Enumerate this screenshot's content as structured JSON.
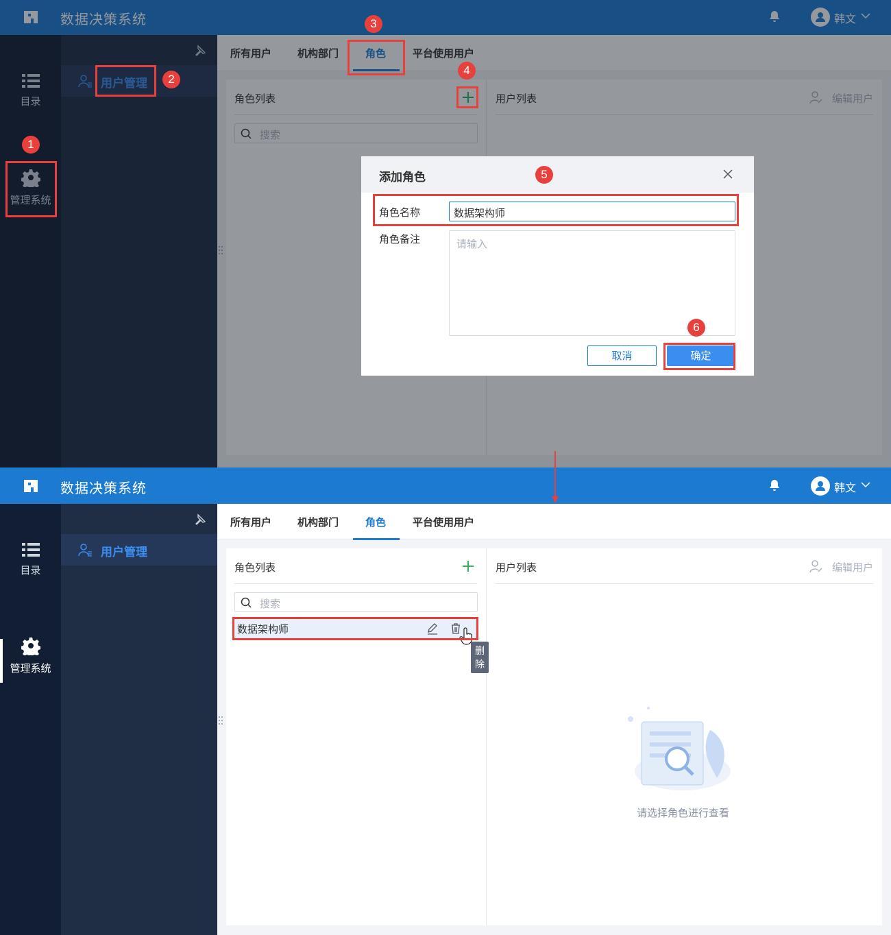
{
  "app": {
    "title": "数据决策系统",
    "user": "韩文"
  },
  "rail": {
    "catalog": "目录",
    "admin": "管理系统"
  },
  "subnav": {
    "user_mgmt": "用户管理"
  },
  "tabs": [
    "所有用户",
    "机构部门",
    "角色",
    "平台使用用户"
  ],
  "panels": {
    "role_list_title": "角色列表",
    "search_placeholder": "搜索",
    "user_list_title": "用户列表",
    "edit_user": "编辑用户",
    "empty_text": "请选择角色进行查看"
  },
  "dialog": {
    "title": "添加角色",
    "name_label": "角色名称",
    "name_value": "数据架构师",
    "note_label": "角色备注",
    "note_placeholder": "请输入",
    "cancel": "取消",
    "ok": "确定"
  },
  "roles": [
    {
      "name": "数据架构师"
    }
  ],
  "tooltip": "删除",
  "step_badges": [
    "1",
    "2",
    "3",
    "4",
    "5",
    "6"
  ],
  "colors": {
    "brand": "#1c7ad1",
    "annotation": "#e8413d",
    "add": "#2fb45b"
  }
}
